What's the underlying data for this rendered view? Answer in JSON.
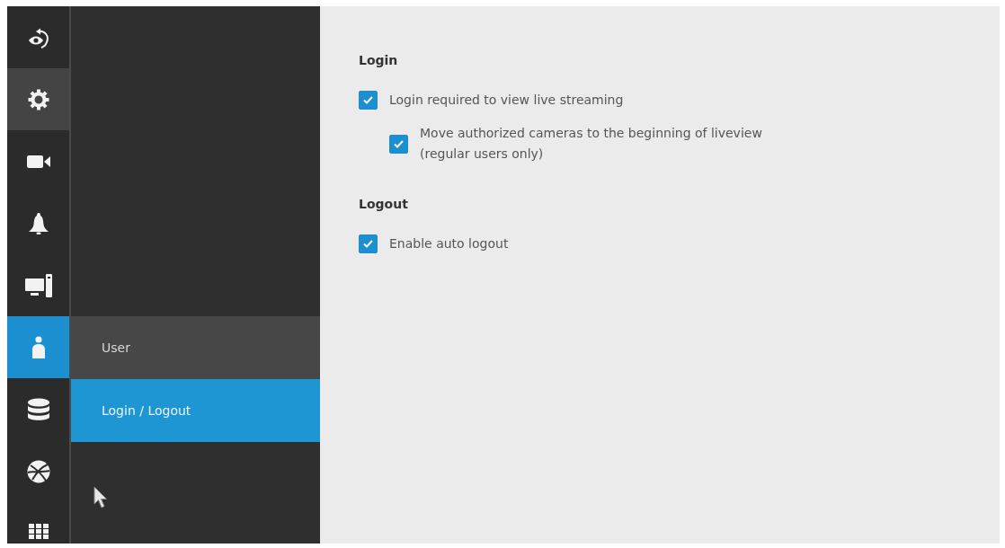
{
  "rail": [
    {
      "selected": false,
      "highlighted": false
    },
    {
      "selected": false,
      "highlighted": true
    },
    {
      "selected": false,
      "highlighted": false
    },
    {
      "selected": false,
      "highlighted": false
    },
    {
      "selected": false,
      "highlighted": false
    },
    {
      "selected": true,
      "highlighted": false
    },
    {
      "selected": false,
      "highlighted": false
    },
    {
      "selected": false,
      "highlighted": false
    },
    {
      "selected": false,
      "highlighted": false
    }
  ],
  "submenu": [
    {
      "label": "User",
      "selected": false
    },
    {
      "label": "Login / Logout",
      "selected": true
    }
  ],
  "content": {
    "sections": [
      {
        "title": "Login",
        "options": [
          {
            "label": "Login required to view live streaming",
            "checked": true,
            "children": [
              {
                "label": "Move authorized cameras to the beginning of liveview (regular users only)",
                "checked": true
              }
            ]
          }
        ]
      },
      {
        "title": "Logout",
        "options": [
          {
            "label": "Enable auto logout",
            "checked": true
          }
        ]
      }
    ]
  }
}
